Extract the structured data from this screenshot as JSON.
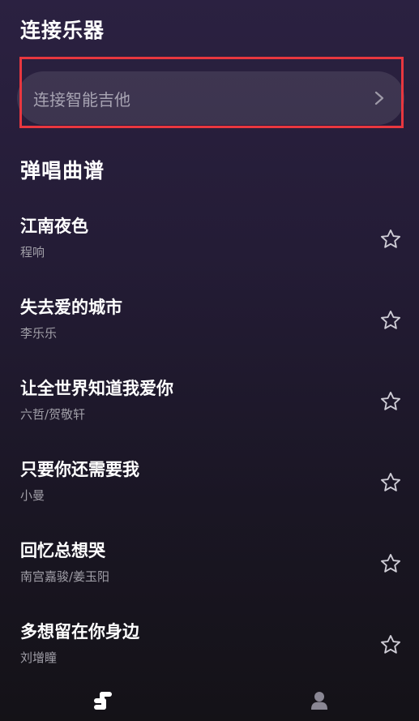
{
  "connect_section": {
    "title": "连接乐器",
    "button_label": "连接智能吉他"
  },
  "songs_section": {
    "title": "弹唱曲谱",
    "songs": [
      {
        "title": "江南夜色",
        "artist": "程响"
      },
      {
        "title": "失去爱的城市",
        "artist": "李乐乐"
      },
      {
        "title": "让全世界知道我爱你",
        "artist": "六哲/贺敬轩"
      },
      {
        "title": "只要你还需要我",
        "artist": "小曼"
      },
      {
        "title": "回忆总想哭",
        "artist": "南宫嘉骏/姜玉阳"
      },
      {
        "title": "多想留在你身边",
        "artist": "刘增瞳"
      }
    ]
  },
  "icons": {
    "chevron": "chevron-right-icon",
    "favorite": "star-outline-icon",
    "nav_home": "music-home-icon",
    "nav_profile": "person-icon"
  },
  "colors": {
    "highlight": "#e8373f",
    "accent_text": "#ffffff",
    "muted_text": "#a19fa8"
  }
}
